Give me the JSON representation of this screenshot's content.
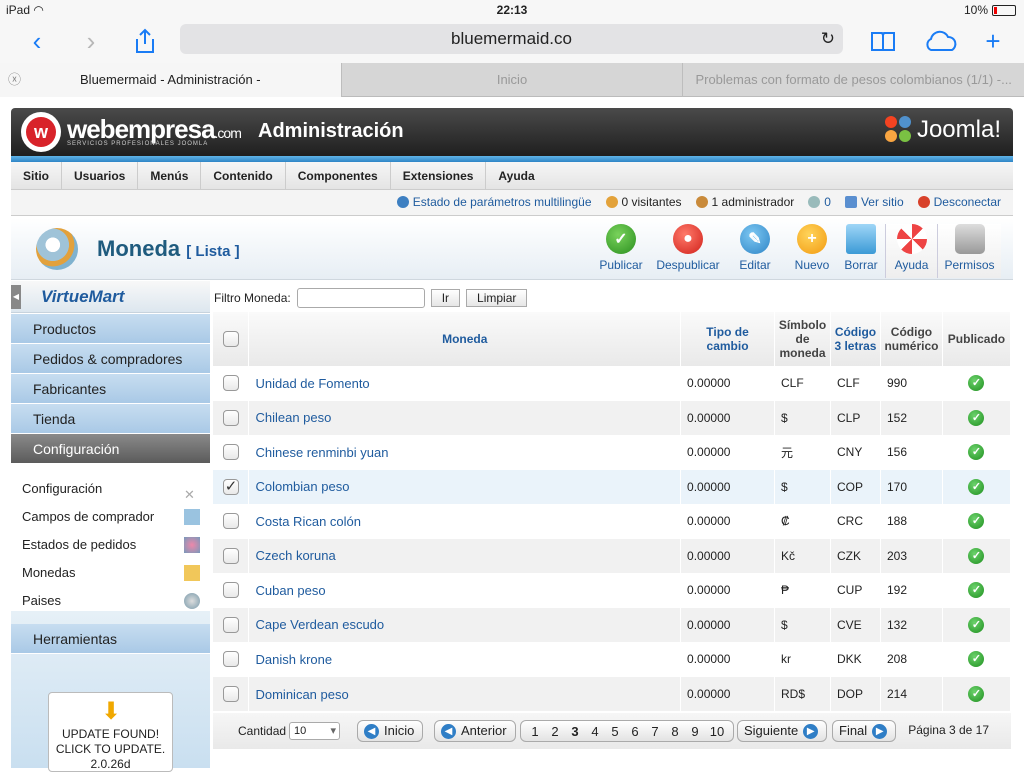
{
  "status_bar": {
    "device": "iPad",
    "time": "22:13",
    "battery": "10%"
  },
  "browser": {
    "url": "bluemermaid.co",
    "tabs": [
      {
        "label": "Bluemermaid - Administración -"
      },
      {
        "label": "Inicio"
      },
      {
        "label": "Problemas con formato de pesos colombianos (1/1) -..."
      }
    ]
  },
  "header": {
    "brand": "webempresa",
    "brand_suffix": ".com",
    "brand_sub": "SERVICIOS PROFESIONALES JOOMLA",
    "title": "Administración",
    "joomla": "Joomla!"
  },
  "menu": [
    "Sitio",
    "Usuarios",
    "Menús",
    "Contenido",
    "Componentes",
    "Extensiones",
    "Ayuda"
  ],
  "status_items": {
    "multilang": "Estado de parámetros multilingüe",
    "visitors": "0 visitantes",
    "admins": "1 administrador",
    "messages": "0",
    "view_site": "Ver sitio",
    "logout": "Desconectar"
  },
  "page": {
    "title": "Moneda",
    "subtitle": "[ Lista ]"
  },
  "actions": {
    "publish": "Publicar",
    "unpublish": "Despublicar",
    "edit": "Editar",
    "new": "Nuevo",
    "delete": "Borrar",
    "help": "Ayuda",
    "permissions": "Permisos"
  },
  "sidebar": {
    "logo": "VirtueMart",
    "items": [
      "Productos",
      "Pedidos & compradores",
      "Fabricantes",
      "Tienda",
      "Configuración"
    ],
    "subitems": [
      "Configuración",
      "Campos de comprador",
      "Estados de pedidos",
      "Monedas",
      "Paises"
    ],
    "tools": "Herramientas",
    "update_line1": "UPDATE FOUND!",
    "update_line2": "CLICK TO UPDATE.",
    "update_line3": "2.0.26d"
  },
  "filter": {
    "label": "Filtro Moneda:",
    "value": "",
    "go": "Ir",
    "clear": "Limpiar"
  },
  "table": {
    "headers": {
      "currency": "Moneda",
      "rate": "Tipo de cambio",
      "symbol": "Símbolo de moneda",
      "code3": "Código 3 letras",
      "numeric": "Código numérico",
      "published": "Publicado"
    },
    "rows": [
      {
        "name": "Unidad de Fomento",
        "rate": "0.00000",
        "symbol": "CLF",
        "code": "CLF",
        "num": "990"
      },
      {
        "name": "Chilean peso",
        "rate": "0.00000",
        "symbol": "$",
        "code": "CLP",
        "num": "152"
      },
      {
        "name": "Chinese renminbi yuan",
        "rate": "0.00000",
        "symbol": "元",
        "code": "CNY",
        "num": "156"
      },
      {
        "name": "Colombian peso",
        "rate": "0.00000",
        "symbol": "$",
        "code": "COP",
        "num": "170"
      },
      {
        "name": "Costa Rican colón",
        "rate": "0.00000",
        "symbol": "₡",
        "code": "CRC",
        "num": "188"
      },
      {
        "name": "Czech koruna",
        "rate": "0.00000",
        "symbol": "Kč",
        "code": "CZK",
        "num": "203"
      },
      {
        "name": "Cuban peso",
        "rate": "0.00000",
        "symbol": "₱",
        "code": "CUP",
        "num": "192"
      },
      {
        "name": "Cape Verdean escudo",
        "rate": "0.00000",
        "symbol": "$",
        "code": "CVE",
        "num": "132"
      },
      {
        "name": "Danish krone",
        "rate": "0.00000",
        "symbol": "kr",
        "code": "DKK",
        "num": "208"
      },
      {
        "name": "Dominican peso",
        "rate": "0.00000",
        "symbol": "RD$",
        "code": "DOP",
        "num": "214"
      }
    ]
  },
  "pager": {
    "label": "Cantidad",
    "limit": "10",
    "start": "Inicio",
    "prev": "Anterior",
    "pages": [
      "1",
      "2",
      "3",
      "4",
      "5",
      "6",
      "7",
      "8",
      "9",
      "10"
    ],
    "next": "Siguiente",
    "end": "Final",
    "info": "Página 3 de 17"
  },
  "icons": {
    "back": "chevron-left-icon",
    "forward": "chevron-right-icon",
    "share": "share-icon",
    "bookmarks": "book-icon",
    "cloud": "cloud-icon",
    "new_tab": "plus-icon"
  }
}
